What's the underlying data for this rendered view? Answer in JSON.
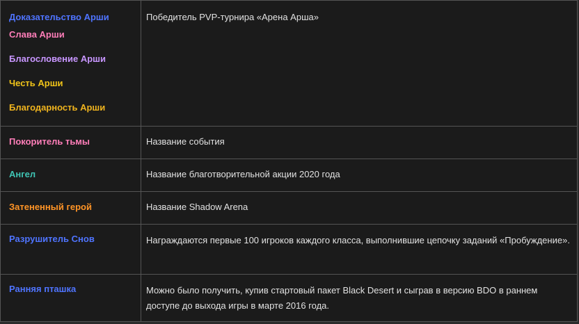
{
  "rows": [
    {
      "titles": [
        {
          "text": "Доказательство Арши",
          "color": "#4f74ff"
        },
        {
          "text": "Слава Арши",
          "color": "#ff7eb9"
        },
        {
          "text": "Благословение Арши",
          "color": "#c896ff"
        },
        {
          "text": "Честь Арши",
          "color": "#f0c419"
        },
        {
          "text": "Благодарность Арши",
          "color": "#f0b41e"
        }
      ],
      "description": "Победитель PVP-турнира «Арена Арша»"
    },
    {
      "titles": [
        {
          "text": "Покоритель тьмы",
          "color": "#ff7eb9"
        }
      ],
      "description": "Название события"
    },
    {
      "titles": [
        {
          "text": "Ангел",
          "color": "#3fc4b4"
        }
      ],
      "description": "Название благотворительной акции 2020 года"
    },
    {
      "titles": [
        {
          "text": "Затененный герой",
          "color": "#ff9426"
        }
      ],
      "description": "Название Shadow Arena"
    },
    {
      "titles": [
        {
          "text": "Разрушитель Снов",
          "color": "#4f74ff"
        }
      ],
      "description": "Награждаются первые 100 игроков каждого класса, выполнившие цепочку заданий «Пробуждение»."
    },
    {
      "titles": [
        {
          "text": "Ранняя пташка",
          "color": "#4f74ff"
        }
      ],
      "description": "Можно было получить, купив стартовый пакет Black Desert и сыграв в версию BDO в раннем доступе до выхода игры в марте 2016 года."
    }
  ]
}
